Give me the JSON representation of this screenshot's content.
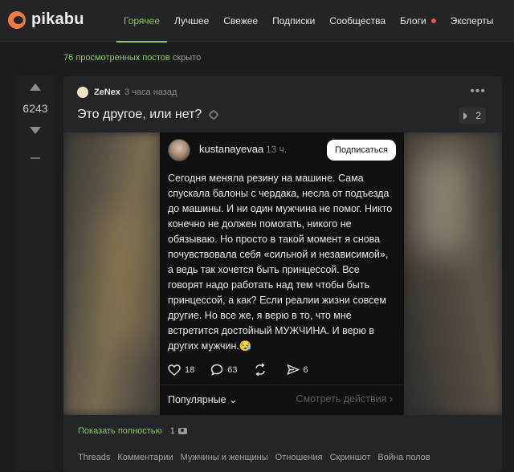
{
  "header": {
    "logo_text": "pikabu",
    "nav": [
      {
        "label": "Горячее",
        "active": true
      },
      {
        "label": "Лучшее"
      },
      {
        "label": "Свежее"
      },
      {
        "label": "Подписки"
      },
      {
        "label": "Сообщества"
      },
      {
        "label": "Блоги"
      },
      {
        "label": "Эксперты"
      }
    ],
    "accent_color": "#8ac858"
  },
  "hidden_posts": {
    "count": "76",
    "text": "просмотренных постов",
    "hidden_label": "скрыто"
  },
  "post": {
    "rating": "6243",
    "author": "ZeNex",
    "time": "3 часа назад",
    "title": "Это другое, или нет?",
    "comments_count": "2",
    "show_full_label": "Показать полностью",
    "media_count": "1",
    "tags": [
      "Threads",
      "Комментарии",
      "Мужчины и женщины",
      "Отношения",
      "Скриншот",
      "Война полов"
    ]
  },
  "screenshot": {
    "username": "kustanayevaa",
    "time": "13 ч.",
    "follow_label": "Подписаться",
    "text": "Сегодня меняла резину на машине. Сама спускала балоны с чердака, несла от подъезда до машины. И ни один мужчина не помог. Никто конечно не должен помогать, никого не обязываю. Но просто в такой момент я снова почувствовала себя «сильной и независимой», а ведь так хочется быть принцессой. Все говорят надо работать над тем чтобы быть принцессой, а как? Если реалии жизни совсем другие. Но все же, я верю в то, что мне встретится достойный МУЖЧИНА. И верю в других мужчин.😪",
    "likes": "18",
    "comments": "63",
    "shares": "6",
    "popular_label": "Популярные ⌄",
    "activity_label": "Смотреть действия ›"
  }
}
